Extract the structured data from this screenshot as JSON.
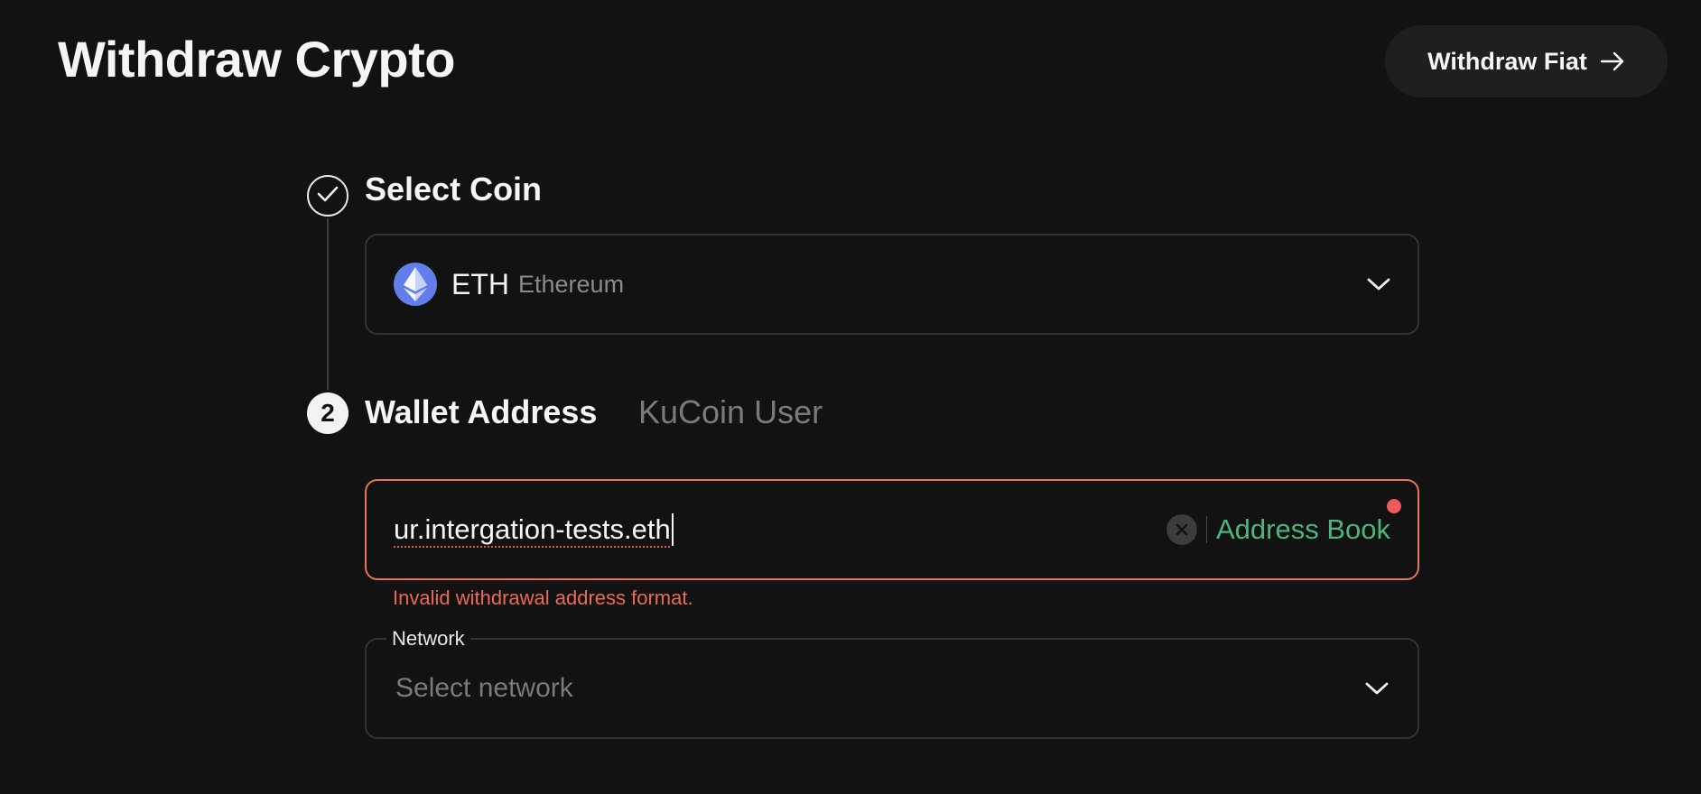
{
  "header": {
    "title": "Withdraw Crypto",
    "fiat_button_label": "Withdraw Fiat"
  },
  "steps": [
    {
      "number": "1",
      "status": "completed",
      "title": "Select Coin"
    },
    {
      "number": "2",
      "status": "active",
      "title": "Wallet Address"
    }
  ],
  "coin_select": {
    "symbol": "ETH",
    "name": "Ethereum",
    "logo_color": "#627eea"
  },
  "address_tabs": {
    "inactive_tab": "KuCoin User"
  },
  "address_input": {
    "value": "ur.intergation-tests.eth",
    "address_book_label": "Address Book",
    "error": "Invalid withdrawal address format."
  },
  "network": {
    "label": "Network",
    "placeholder": "Select network"
  },
  "colors": {
    "background": "#121212",
    "error": "#ec6a55",
    "accent_green": "#4fb37e",
    "notify_dot": "#ef5a5a"
  }
}
